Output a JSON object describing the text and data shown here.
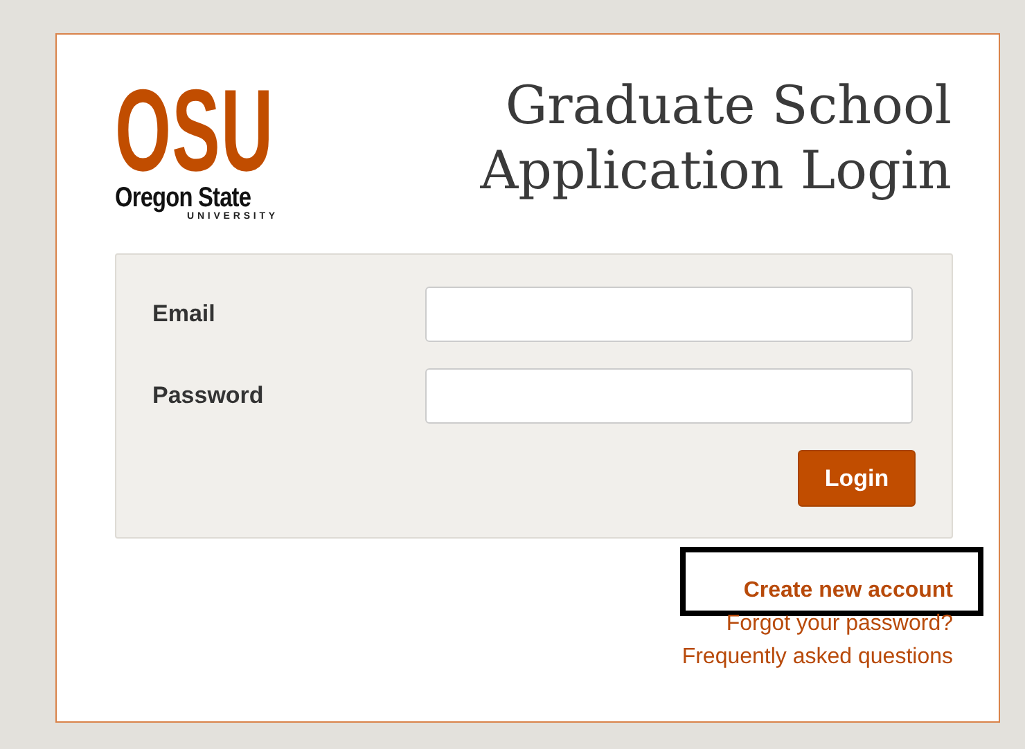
{
  "logo": {
    "mark": "OSU",
    "name": "Oregon State",
    "sub": "UNIVERSITY"
  },
  "title": [
    "Graduate School",
    "Application Login"
  ],
  "form": {
    "fields": [
      {
        "label": "Email"
      },
      {
        "label": "Password"
      }
    ],
    "button": "Login"
  },
  "links": [
    {
      "text": "Create new account",
      "bold": true,
      "highlighted": true
    },
    {
      "text": "Forgot your password?",
      "bold": false,
      "highlighted": false
    },
    {
      "text": "Frequently asked questions",
      "bold": false,
      "highlighted": false
    }
  ]
}
